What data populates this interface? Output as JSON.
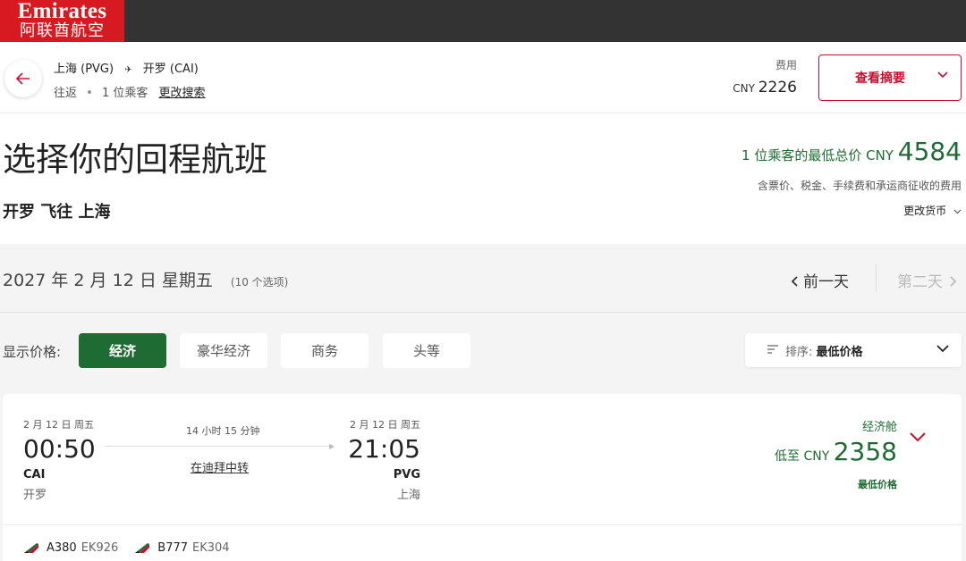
{
  "brand": {
    "name_en": "Emirates",
    "name_cn": "阿联酋航空",
    "color": "#d71921"
  },
  "summary": {
    "origin": "上海 (PVG)",
    "destination": "开罗 (CAI)",
    "trip_type": "往返",
    "passengers": "1 位乘客",
    "modify_search": "更改搜索",
    "fare_label": "费用",
    "fare_currency": "CNY",
    "fare_amount": "2226",
    "summary_button": "查看摘要"
  },
  "heading": {
    "title": "选择你的回程航班",
    "subtitle": "开罗 飞往 上海",
    "lowest_prefix": "1 位乘客的最低总价 CNY",
    "lowest_amount": "4584",
    "lowest_note": "含票价、税金、手续费和承运商征收的费用",
    "change_currency": "更改货币"
  },
  "date_nav": {
    "date": "2027 年 2 月 12 日 星期五",
    "options": "(10 个选项)",
    "prev": "前一天",
    "next": "第二天"
  },
  "filters": {
    "label": "显示价格:",
    "cabins": [
      "经济",
      "豪华经济",
      "商务",
      "头等"
    ],
    "active_cabin": "经济",
    "sort_label": "排序:",
    "sort_value": "最低价格"
  },
  "flight": {
    "dep_date": "2 月 12 日 周五",
    "dep_time": "00:50",
    "dep_code": "CAI",
    "dep_city": "开罗",
    "duration": "14 小时 15 分钟",
    "transfer": "在迪拜中转",
    "arr_date": "2 月 12 日 周五",
    "arr_time": "21:05",
    "arr_code": "PVG",
    "arr_city": "上海",
    "cabin": "经济舱",
    "price_prefix": "低至 CNY",
    "price": "2358",
    "price_tag": "最低价格",
    "segments": [
      {
        "aircraft": "A380",
        "flight_no": "EK926"
      },
      {
        "aircraft": "B777",
        "flight_no": "EK304"
      }
    ]
  },
  "colors": {
    "accent_red": "#c8102e",
    "green": "#1e6b34"
  }
}
